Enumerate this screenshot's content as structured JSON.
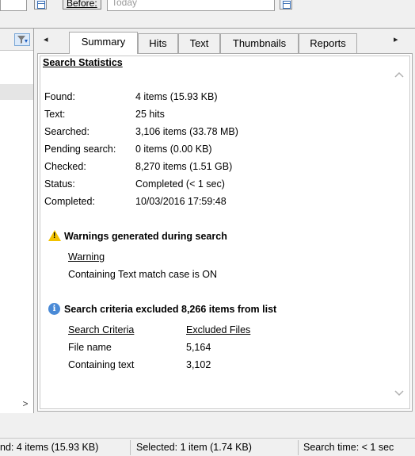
{
  "filter": {
    "before_label": "Before:",
    "before_placeholder": "Today"
  },
  "tabs": {
    "scroll_left": "◂",
    "scroll_right": "▸",
    "items": [
      "Summary",
      "Hits",
      "Text",
      "Thumbnails",
      "Reports"
    ],
    "active": "Summary"
  },
  "summary": {
    "heading": "Search Statistics",
    "stats": [
      {
        "label": "Found:",
        "value": "4 items (15.93 KB)"
      },
      {
        "label": "Text:",
        "value": "25 hits"
      },
      {
        "label": "Searched:",
        "value": "3,106 items (33.78 MB)"
      },
      {
        "label": "Pending search:",
        "value": "0 items (0.00 KB)"
      },
      {
        "label": "Checked:",
        "value": "8,270 items (1.51 GB)"
      },
      {
        "label": "Status:",
        "value": "Completed (< 1 sec)"
      },
      {
        "label": "Completed:",
        "value": "10/03/2016 17:59:48"
      }
    ],
    "warnings": {
      "title": "Warnings generated during search",
      "column_header": "Warning",
      "items": [
        "Containing Text match case is ON"
      ]
    },
    "criteria": {
      "title": "Search criteria excluded 8,266 items from list",
      "col1": "Search Criteria",
      "col2": "Excluded Files",
      "rows": [
        {
          "criteria": "File name",
          "excluded": "5,164"
        },
        {
          "criteria": "Containing text",
          "excluded": "3,102"
        }
      ]
    }
  },
  "left_pane": {
    "scroll_right": ">"
  },
  "status_bar": {
    "found": "nd: 4 items (15.93 KB)",
    "selected": "Selected: 1 item (1.74 KB)",
    "search_time": "Search time: < 1 sec"
  },
  "icons": {
    "filter": "filter-icon",
    "warning": "warning-icon",
    "info": "info-icon",
    "calendar": "calendar-icon"
  }
}
